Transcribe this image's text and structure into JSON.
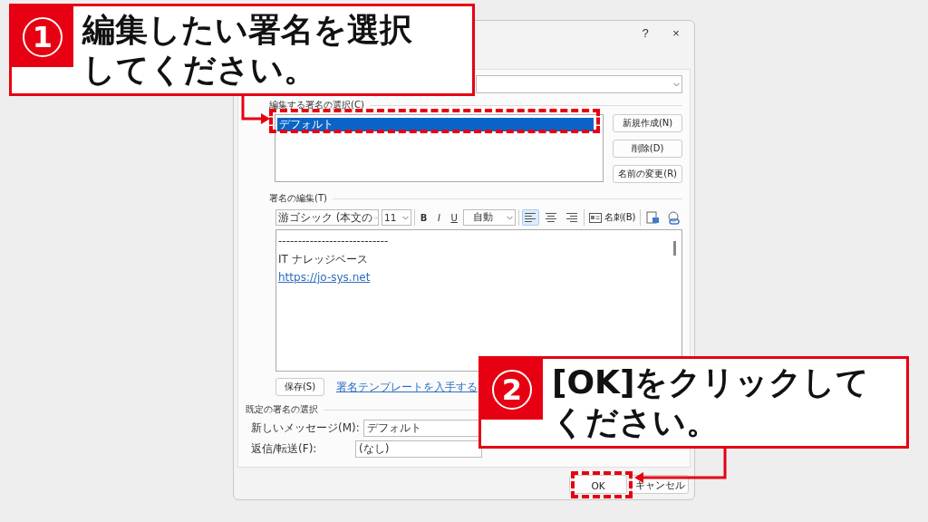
{
  "dialog": {
    "help": "?",
    "close": "×"
  },
  "signature_list": {
    "label": "編集する署名の選択(C)",
    "items": [
      {
        "label": "デフォルト",
        "selected": true
      }
    ],
    "buttons": [
      "新規作成(N)",
      "削除(D)",
      "名前の変更(R)"
    ]
  },
  "editor": {
    "label": "署名の編集(T)",
    "font": "游ゴシック (本文の",
    "size": "11",
    "format_buttons": [
      "B",
      "I",
      "U"
    ],
    "color_menu": "自動",
    "align": [
      {
        "kind": "left",
        "selected": true
      },
      {
        "kind": "center",
        "selected": false
      },
      {
        "kind": "right",
        "selected": false
      }
    ],
    "card_button": "名刺(B)",
    "lines": [
      {
        "kind": "text",
        "text": "----------------------------"
      },
      {
        "kind": "text",
        "text": "IT ナレッジベース"
      },
      {
        "kind": "link",
        "text": "https://jo-sys.net"
      }
    ]
  },
  "save_button": "保存(S)",
  "template_link": "署名テンプレートを入手する",
  "defaults": {
    "label": "既定の署名の選択",
    "rows": [
      {
        "label": "新しいメッセージ(M):",
        "value": "デフォルト"
      },
      {
        "label": "返信/転送(F):",
        "value": "(なし)"
      }
    ]
  },
  "footer_buttons": [
    "OK",
    "キャンセル"
  ],
  "callouts": [
    {
      "number": "1",
      "text": "編集したい署名を選択してください。"
    },
    {
      "number": "2",
      "text": "[OK]をクリックしてください。"
    }
  ]
}
